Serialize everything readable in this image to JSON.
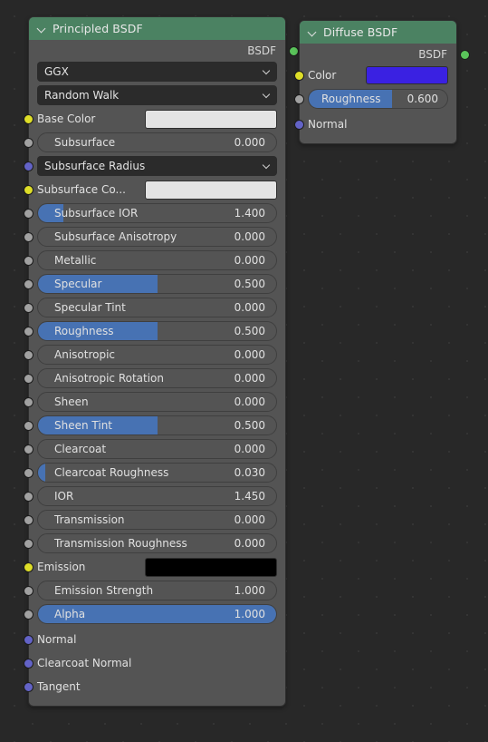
{
  "canvas": {
    "background": "#282828",
    "grid_dot": "#343434"
  },
  "colors": {
    "header_green": "#4b8262",
    "node_body": "#545454",
    "slider_blue": "#4772b3",
    "socket_green": "#5ac35a",
    "socket_yellow": "#dede28",
    "socket_grey": "#a1a1a1",
    "socket_purple": "#6363c7"
  },
  "nodes": [
    {
      "id": "principled-bsdf",
      "title": "Principled BSDF",
      "output": {
        "label": "BSDF",
        "socket": "green"
      },
      "enums": [
        {
          "name": "distribution",
          "value": "GGX"
        },
        {
          "name": "subsurface-method",
          "value": "Random Walk"
        }
      ],
      "rows": [
        {
          "kind": "color",
          "name": "base-color",
          "label": "Base Color",
          "socket": "yellow",
          "swatch": "#e3e3e3"
        },
        {
          "kind": "slider",
          "name": "subsurface",
          "label": "Subsurface",
          "socket": "grey",
          "value": "0.000",
          "fill": 0
        },
        {
          "kind": "dropdown",
          "name": "subsurface-radius",
          "label": "Subsurface Radius",
          "socket": "purple"
        },
        {
          "kind": "color",
          "name": "subsurface-color",
          "label": "Subsurface Co...",
          "socket": "yellow",
          "swatch": "#e3e3e3"
        },
        {
          "kind": "slider",
          "name": "subsurface-ior",
          "label": "Subsurface IOR",
          "socket": "grey",
          "value": "1.400",
          "fill": 10.5
        },
        {
          "kind": "slider",
          "name": "subsurface-anisotropy",
          "label": "Subsurface Anisotropy",
          "socket": "grey",
          "value": "0.000",
          "fill": 0
        },
        {
          "kind": "slider",
          "name": "metallic",
          "label": "Metallic",
          "socket": "grey",
          "value": "0.000",
          "fill": 0
        },
        {
          "kind": "slider",
          "name": "specular",
          "label": "Specular",
          "socket": "grey",
          "value": "0.500",
          "fill": 50
        },
        {
          "kind": "slider",
          "name": "specular-tint",
          "label": "Specular Tint",
          "socket": "grey",
          "value": "0.000",
          "fill": 0
        },
        {
          "kind": "slider",
          "name": "roughness",
          "label": "Roughness",
          "socket": "grey",
          "value": "0.500",
          "fill": 50
        },
        {
          "kind": "slider",
          "name": "anisotropic",
          "label": "Anisotropic",
          "socket": "grey",
          "value": "0.000",
          "fill": 0
        },
        {
          "kind": "slider",
          "name": "anisotropic-rotation",
          "label": "Anisotropic Rotation",
          "socket": "grey",
          "value": "0.000",
          "fill": 0
        },
        {
          "kind": "slider",
          "name": "sheen",
          "label": "Sheen",
          "socket": "grey",
          "value": "0.000",
          "fill": 0
        },
        {
          "kind": "slider",
          "name": "sheen-tint",
          "label": "Sheen Tint",
          "socket": "grey",
          "value": "0.500",
          "fill": 50
        },
        {
          "kind": "slider",
          "name": "clearcoat",
          "label": "Clearcoat",
          "socket": "grey",
          "value": "0.000",
          "fill": 0
        },
        {
          "kind": "slider",
          "name": "clearcoat-roughness",
          "label": "Clearcoat Roughness",
          "socket": "grey",
          "value": "0.030",
          "fill": 3
        },
        {
          "kind": "slider",
          "name": "ior",
          "label": "IOR",
          "socket": "grey",
          "value": "1.450",
          "fill": 0
        },
        {
          "kind": "slider",
          "name": "transmission",
          "label": "Transmission",
          "socket": "grey",
          "value": "0.000",
          "fill": 0
        },
        {
          "kind": "slider",
          "name": "transmission-roughness",
          "label": "Transmission Roughness",
          "socket": "grey",
          "value": "0.000",
          "fill": 0
        },
        {
          "kind": "color",
          "name": "emission",
          "label": "Emission",
          "socket": "yellow",
          "swatch": "#000000"
        },
        {
          "kind": "slider",
          "name": "emission-strength",
          "label": "Emission Strength",
          "socket": "grey",
          "value": "1.000",
          "fill": 0
        },
        {
          "kind": "slider",
          "name": "alpha",
          "label": "Alpha",
          "socket": "grey",
          "value": "1.000",
          "fill": 100
        },
        {
          "kind": "plain",
          "name": "normal",
          "label": "Normal",
          "socket": "purple"
        },
        {
          "kind": "plain",
          "name": "clearcoat-normal",
          "label": "Clearcoat Normal",
          "socket": "purple"
        },
        {
          "kind": "plain",
          "name": "tangent",
          "label": "Tangent",
          "socket": "purple"
        }
      ]
    },
    {
      "id": "diffuse-bsdf",
      "title": "Diffuse BSDF",
      "output": {
        "label": "BSDF",
        "socket": "green"
      },
      "enums": [],
      "rows": [
        {
          "kind": "color",
          "name": "color",
          "label": "Color",
          "socket": "yellow",
          "swatch": "#3a21e2"
        },
        {
          "kind": "slider",
          "name": "roughness",
          "label": "Roughness",
          "socket": "grey",
          "value": "0.600",
          "fill": 60
        },
        {
          "kind": "plain",
          "name": "normal",
          "label": "Normal",
          "socket": "purple"
        }
      ]
    }
  ]
}
